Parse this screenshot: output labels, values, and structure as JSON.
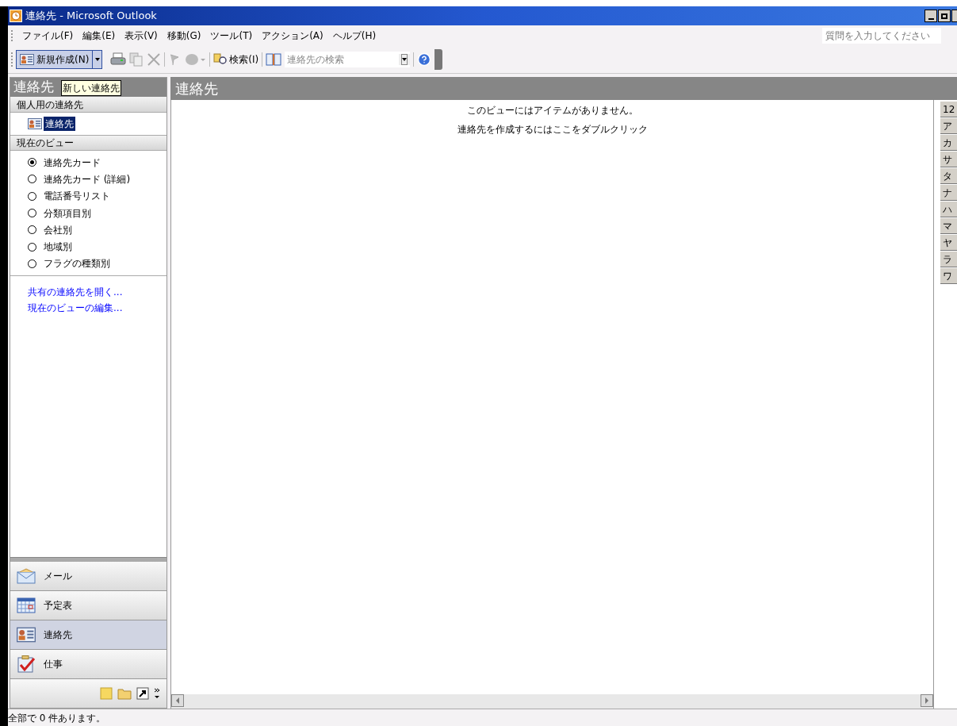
{
  "window": {
    "title": "連絡先 - Microsoft Outlook"
  },
  "menu": [
    {
      "label": "ファイル(F)"
    },
    {
      "label": "編集(E)"
    },
    {
      "label": "表示(V)"
    },
    {
      "label": "移動(G)"
    },
    {
      "label": "ツール(T)"
    },
    {
      "label": "アクション(A)"
    },
    {
      "label": "ヘルプ(H)"
    }
  ],
  "help_field": {
    "placeholder": "質問を入力してください"
  },
  "toolbar": {
    "new_button": "新規作成(N)",
    "search_button": "検索(I)",
    "search_field": {
      "placeholder": "連絡先の検索"
    }
  },
  "tooltip": "新しい連絡先",
  "navigation_pane": {
    "title": "連絡先",
    "my_contacts": {
      "header": "個人用の連絡先",
      "items": [
        {
          "label": "連絡先",
          "selected": true
        }
      ]
    },
    "current_view": {
      "header": "現在のビュー",
      "views": [
        {
          "label": "連絡先カード",
          "selected": true
        },
        {
          "label": "連絡先カード (詳細)",
          "selected": false
        },
        {
          "label": "電話番号リスト",
          "selected": false
        },
        {
          "label": "分類項目別",
          "selected": false
        },
        {
          "label": "会社別",
          "selected": false
        },
        {
          "label": "地域別",
          "selected": false
        },
        {
          "label": "フラグの種類別",
          "selected": false
        }
      ]
    },
    "links": [
      "共有の連絡先を開く...",
      "現在のビューの編集..."
    ],
    "buttons": [
      {
        "kind": "mail",
        "label": "メール",
        "selected": false
      },
      {
        "kind": "calendar",
        "label": "予定表",
        "selected": false
      },
      {
        "kind": "contacts",
        "label": "連絡先",
        "selected": true
      },
      {
        "kind": "tasks",
        "label": "仕事",
        "selected": false
      }
    ]
  },
  "main": {
    "header": "連絡先",
    "messages": [
      "このビューにはアイテムがありません。",
      "連絡先を作成するにはここをダブルクリック"
    ]
  },
  "index": [
    "12",
    "ア",
    "カ",
    "サ",
    "タ",
    "ナ",
    "ハ",
    "マ",
    "ヤ",
    "ラ",
    "ワ"
  ],
  "status_bar": {
    "text": "全部で 0 件あります。"
  }
}
